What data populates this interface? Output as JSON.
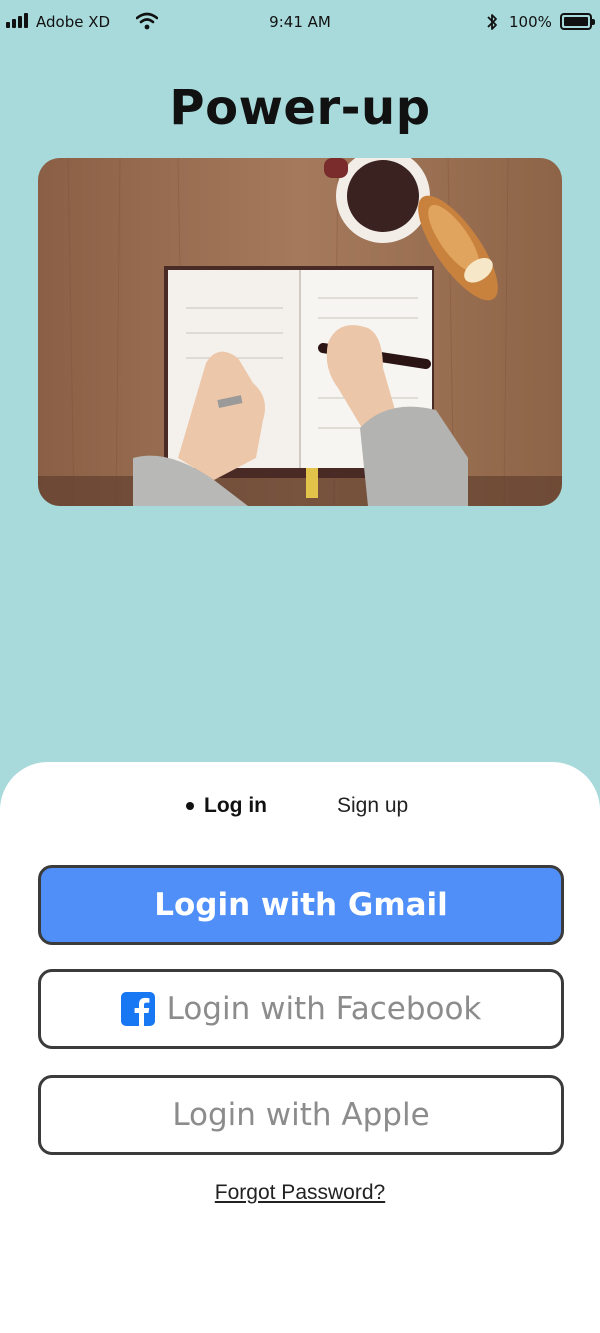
{
  "status_bar": {
    "carrier": "Adobe XD",
    "time": "9:41 AM",
    "battery": "100%"
  },
  "app": {
    "title": "Power-up"
  },
  "hero": {
    "icon": "photo-journal-writing"
  },
  "auth_tabs": {
    "login_label": "Log in",
    "signup_label": "Sign up",
    "active": "Log in"
  },
  "buttons": {
    "gmail_label": "Login with Gmail",
    "facebook_label": "Login with Facebook",
    "apple_label": "Login with Apple"
  },
  "links": {
    "forgot_password": "Forgot Password?"
  },
  "colors": {
    "background": "#a8dadb",
    "primary": "#4f8ff7",
    "facebook": "#1877f2"
  }
}
